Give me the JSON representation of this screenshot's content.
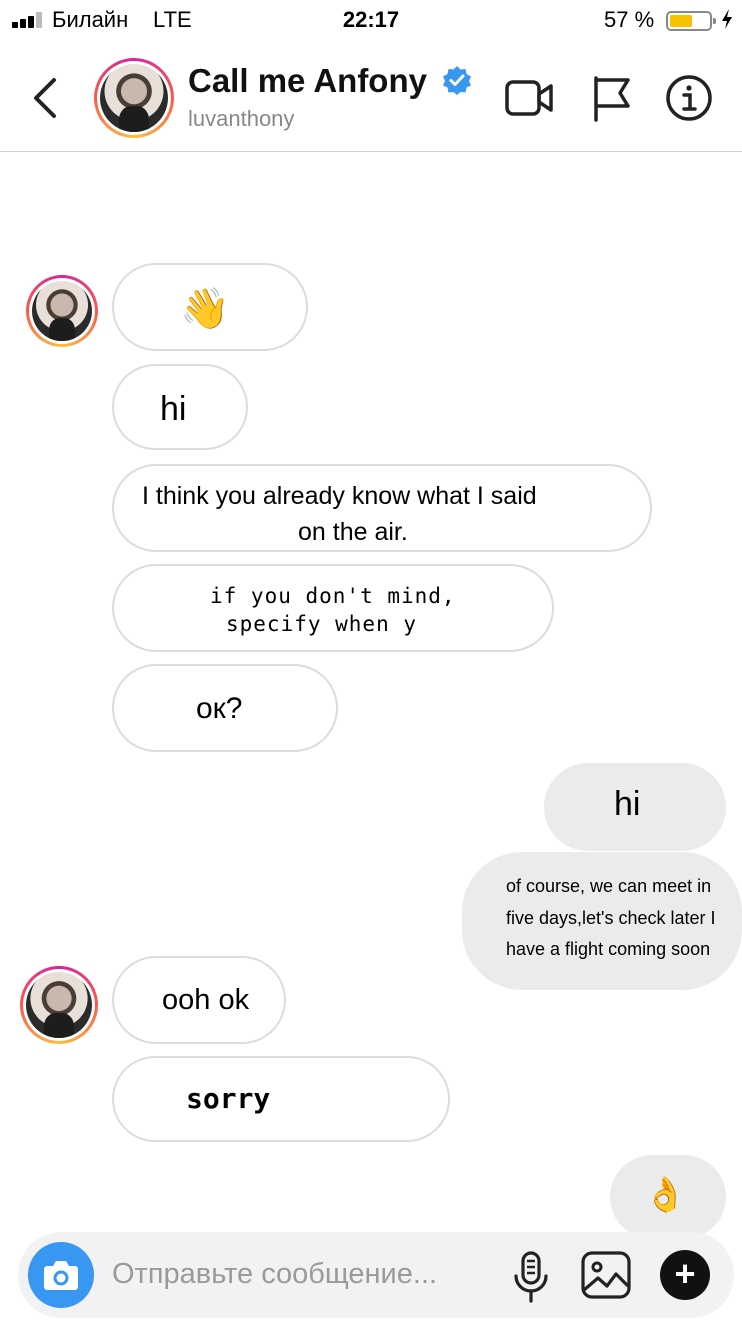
{
  "status_bar": {
    "carrier": "Билайн",
    "network": "LTE",
    "time": "22:17",
    "battery_percent": "57 %",
    "battery_level": 0.57,
    "battery_color": "#f7c300"
  },
  "header": {
    "name": "Call me Anfony",
    "username": "luvanthony",
    "verified": true,
    "icons": [
      "chevron-left-icon",
      "video-camera-icon",
      "flag-icon",
      "info-icon"
    ]
  },
  "messages": [
    {
      "from": "them",
      "text": "👋"
    },
    {
      "from": "them",
      "text": "hi"
    },
    {
      "from": "them",
      "text_line1": "I think you already know what I said",
      "text_line2": "on the air."
    },
    {
      "from": "them",
      "text_line1": "if you don't mind,",
      "text_line2": "specify when y"
    },
    {
      "from": "them",
      "text": "ок?"
    },
    {
      "from": "me",
      "text": "hi"
    },
    {
      "from": "me",
      "text_line1": "of course, we can meet in",
      "text_line2": "five days,let's check later I",
      "text_line3": "have a flight coming soon"
    },
    {
      "from": "them",
      "text": "ooh ok"
    },
    {
      "from": "them",
      "text": "sorry"
    },
    {
      "from": "me",
      "text": "👌"
    }
  ],
  "composer": {
    "placeholder": "Отправьте сообщение...",
    "icons": [
      "camera-icon",
      "microphone-icon",
      "gallery-icon",
      "plus-icon"
    ]
  },
  "colors": {
    "accent_blue": "#3897f0",
    "incoming_border": "#dcdcdc",
    "outgoing_bg": "#ebebeb",
    "verified_blue": "#3897f0"
  }
}
